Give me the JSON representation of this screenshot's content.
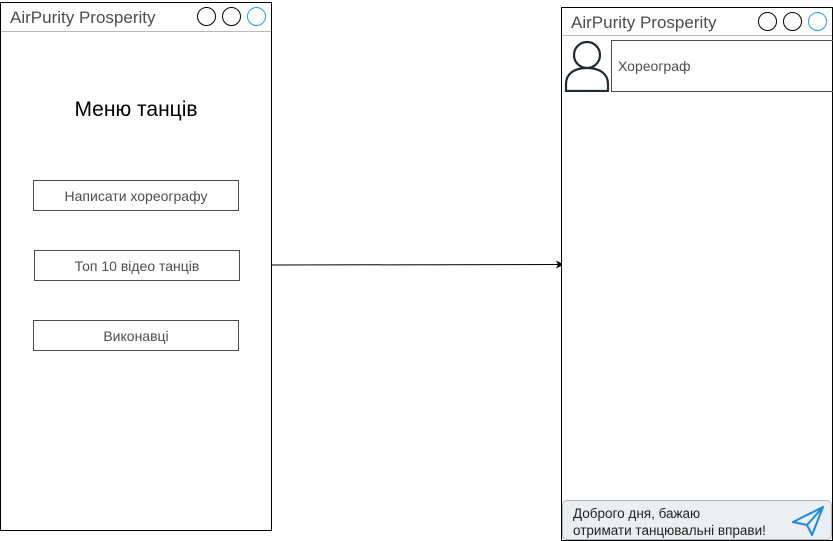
{
  "colors": {
    "title_text": "#4d4d4d",
    "border": "#000000",
    "accent_button": "#1ba1e2",
    "message_bg": "#eceff1",
    "send_icon": "#1e88e5"
  },
  "left_window": {
    "title": "AirPurity Prosperity",
    "heading": "Меню танців",
    "buttons": [
      {
        "label": "Написати хореографу"
      },
      {
        "label": "Топ 10 відео танців"
      },
      {
        "label": "Виконавці"
      }
    ],
    "window_controls": [
      "circle",
      "circle",
      "circle"
    ]
  },
  "right_window": {
    "title": "AirPurity Prosperity",
    "contact": {
      "icon": "user-icon",
      "name": "Хореограф"
    },
    "message": {
      "text": "Доброго дня, бажаю\nотримати танцювальні вправи!",
      "send_icon": "send-icon"
    }
  },
  "connector": {
    "from": "left_window",
    "to": "right_window",
    "style": "arrow"
  }
}
